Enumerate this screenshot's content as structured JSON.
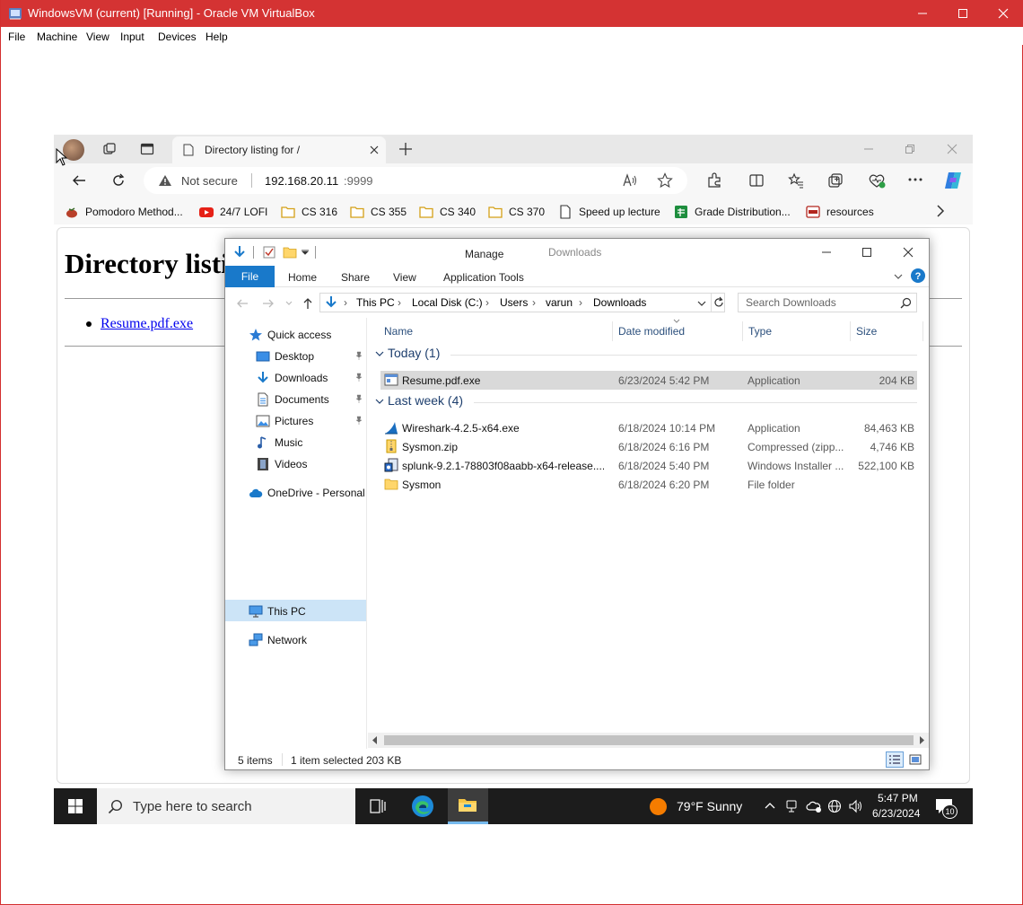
{
  "vbox": {
    "title": "WindowsVM (current) [Running] - Oracle VM VirtualBox",
    "menu": [
      "File",
      "Machine",
      "View",
      "Input",
      "Devices",
      "Help"
    ]
  },
  "browser": {
    "tab_title": "Directory listing for /",
    "security_label": "Not secure",
    "url_host": "192.168.20.11",
    "url_port": ":9999",
    "bookmarks": [
      "Pomodoro Method...",
      "24/7 LOFI",
      "CS 316",
      "CS 355",
      "CS 340",
      "CS 370",
      "Speed up lecture",
      "Grade Distribution...",
      "resources"
    ],
    "page": {
      "heading": "Directory listing for /",
      "links": [
        "Resume.pdf.exe"
      ]
    }
  },
  "explorer": {
    "title": "Downloads",
    "manage_label": "Manage",
    "ribbon_tabs": [
      "File",
      "Home",
      "Share",
      "View",
      "Application Tools"
    ],
    "breadcrumb": [
      "This PC",
      "Local Disk (C:)",
      "Users",
      "varun",
      "Downloads"
    ],
    "search_placeholder": "Search Downloads",
    "nav": {
      "quick_access": "Quick access",
      "pinned": [
        "Desktop",
        "Downloads",
        "Documents",
        "Pictures"
      ],
      "others": [
        "Music",
        "Videos"
      ],
      "onedrive": "OneDrive - Personal",
      "this_pc": "This PC",
      "network": "Network"
    },
    "columns": [
      "Name",
      "Date modified",
      "Type",
      "Size"
    ],
    "groups": [
      {
        "label": "Today (1)",
        "files": [
          {
            "name": "Resume.pdf.exe",
            "date": "6/23/2024 5:42 PM",
            "type": "Application",
            "size": "204 KB",
            "selected": true
          }
        ]
      },
      {
        "label": "Last week (4)",
        "files": [
          {
            "name": "Wireshark-4.2.5-x64.exe",
            "date": "6/18/2024 10:14 PM",
            "type": "Application",
            "size": "84,463 KB"
          },
          {
            "name": "Sysmon.zip",
            "date": "6/18/2024 6:16 PM",
            "type": "Compressed (zipp...",
            "size": "4,746 KB"
          },
          {
            "name": "splunk-9.2.1-78803f08aabb-x64-release....",
            "date": "6/18/2024 5:40 PM",
            "type": "Windows Installer ...",
            "size": "522,100 KB"
          },
          {
            "name": "Sysmon",
            "date": "6/18/2024 6:20 PM",
            "type": "File folder",
            "size": ""
          }
        ]
      }
    ],
    "status": {
      "items": "5 items",
      "selected": "1 item selected",
      "selected_size": "203 KB"
    }
  },
  "taskbar": {
    "search_placeholder": "Type here to search",
    "weather": "79°F  Sunny",
    "time": "5:47 PM",
    "date": "6/23/2024",
    "notification_count": "10"
  },
  "colors": {
    "vbox_titlebar": "#d43333",
    "explorer_accent": "#1979ca",
    "manage_tab": "#e9d3f3",
    "link": "#0000ee"
  }
}
